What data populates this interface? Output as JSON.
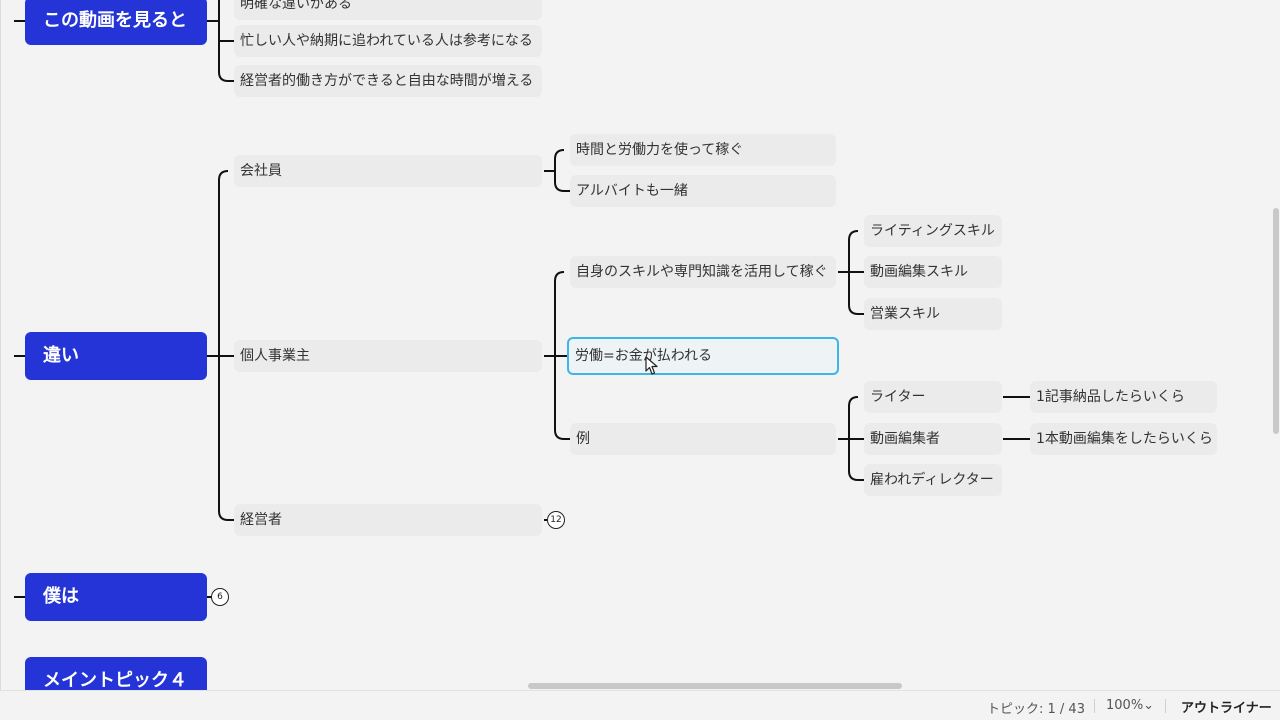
{
  "main_topics": {
    "t1": "この動画を見ると",
    "t2": "違い",
    "t3": "僕は",
    "t4": "メイントピック４"
  },
  "subtopics": {
    "a1": "明確な違いがある",
    "a2": "忙しい人や納期に追われている人は参考になる",
    "a3": "経営者的働き方ができると自由な時間が増える",
    "b1": "会社員",
    "b1a": "時間と労働力を使って稼ぐ",
    "b1b": "アルバイトも一緒",
    "b2": "個人事業主",
    "b2a": "自身のスキルや専門知識を活用して稼ぐ",
    "b2a1": "ライティングスキル",
    "b2a2": "動画編集スキル",
    "b2a3": "営業スキル",
    "b2b": "労働=お金が払われる",
    "b2c": "例",
    "b2c1": "ライター",
    "b2c1a": "1記事納品したらいくら",
    "b2c2": "動画編集者",
    "b2c2a": "1本動画編集をしたらいくら",
    "b2c3": "雇われディレクター",
    "b3": "経営者"
  },
  "badges": {
    "keieisha": "12",
    "bokuwa": "6"
  },
  "status": {
    "topic_count": "トピック: 1 / 43",
    "zoom": "100%",
    "zoom_chevron": "⌄",
    "outliner": "アウトライナー"
  },
  "colors": {
    "main_topic": "#2434d6",
    "selection": "#3db5e8",
    "topic_bg": "#ebebeb",
    "canvas": "#f3f3f3"
  }
}
